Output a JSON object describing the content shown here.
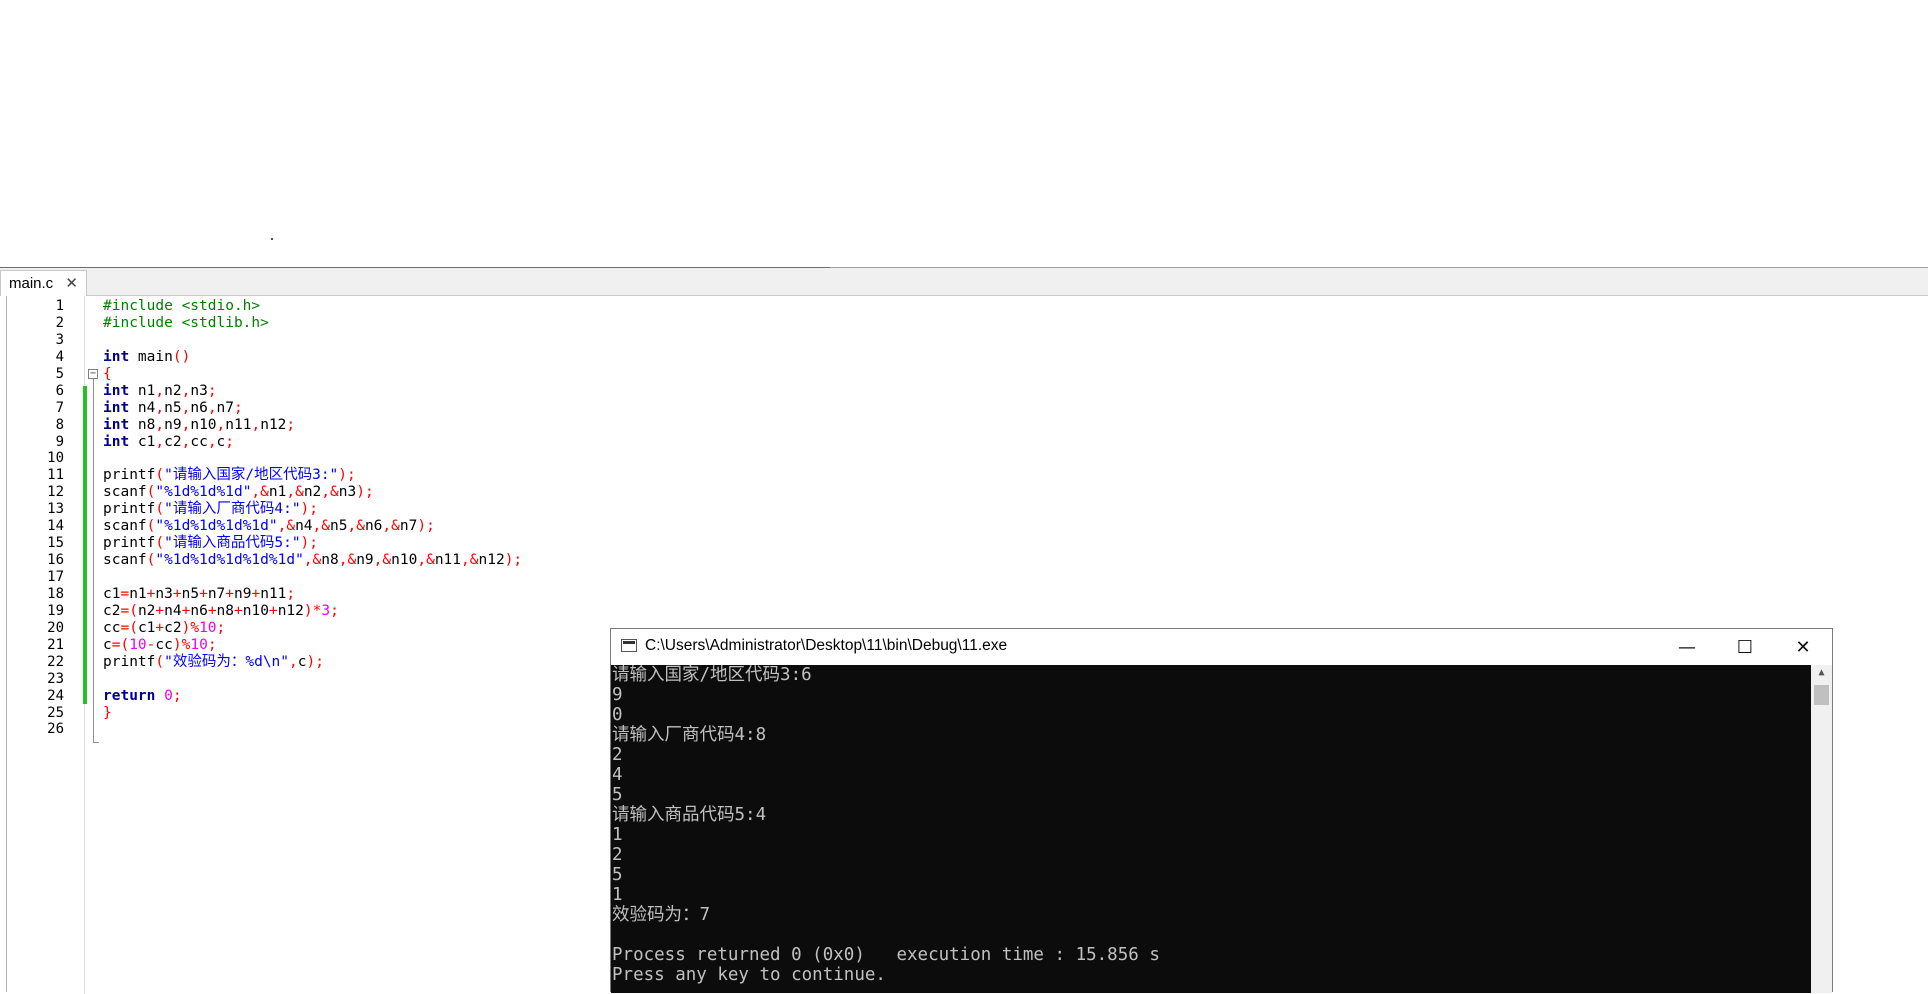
{
  "editor": {
    "tab_label": "main.c",
    "tab_close": "✕",
    "fold_glyph": "−",
    "line_numbers": [
      "1",
      "2",
      "3",
      "4",
      "5",
      "6",
      "7",
      "8",
      "9",
      "10",
      "11",
      "12",
      "13",
      "14",
      "15",
      "16",
      "17",
      "18",
      "19",
      "20",
      "21",
      "22",
      "23",
      "24",
      "25",
      "26"
    ],
    "code_lines": [
      [
        [
          "#include <stdio.h>",
          "pp"
        ]
      ],
      [
        [
          "#include <stdlib.h>",
          "pp"
        ]
      ],
      [],
      [
        [
          "int",
          "kw"
        ],
        [
          " main",
          ""
        ],
        [
          "()",
          "op"
        ]
      ],
      [
        [
          "{",
          "op"
        ]
      ],
      [
        [
          "int",
          "kw"
        ],
        [
          " n1",
          ""
        ],
        [
          ",",
          "op"
        ],
        [
          "n2",
          ""
        ],
        [
          ",",
          "op"
        ],
        [
          "n3",
          ""
        ],
        [
          ";",
          "op"
        ]
      ],
      [
        [
          "int",
          "kw"
        ],
        [
          " n4",
          ""
        ],
        [
          ",",
          "op"
        ],
        [
          "n5",
          ""
        ],
        [
          ",",
          "op"
        ],
        [
          "n6",
          ""
        ],
        [
          ",",
          "op"
        ],
        [
          "n7",
          ""
        ],
        [
          ";",
          "op"
        ]
      ],
      [
        [
          "int",
          "kw"
        ],
        [
          " n8",
          ""
        ],
        [
          ",",
          "op"
        ],
        [
          "n9",
          ""
        ],
        [
          ",",
          "op"
        ],
        [
          "n10",
          ""
        ],
        [
          ",",
          "op"
        ],
        [
          "n11",
          ""
        ],
        [
          ",",
          "op"
        ],
        [
          "n12",
          ""
        ],
        [
          ";",
          "op"
        ]
      ],
      [
        [
          "int",
          "kw"
        ],
        [
          " c1",
          ""
        ],
        [
          ",",
          "op"
        ],
        [
          "c2",
          ""
        ],
        [
          ",",
          "op"
        ],
        [
          "cc",
          ""
        ],
        [
          ",",
          "op"
        ],
        [
          "c",
          ""
        ],
        [
          ";",
          "op"
        ]
      ],
      [],
      [
        [
          "printf",
          ""
        ],
        [
          "(",
          "op"
        ],
        [
          "\"请输入国家/地区代码3:\"",
          "st"
        ],
        [
          ");",
          "op"
        ]
      ],
      [
        [
          "scanf",
          ""
        ],
        [
          "(",
          "op"
        ],
        [
          "\"%1d%1d%1d\"",
          "st"
        ],
        [
          ",&",
          "op"
        ],
        [
          "n1",
          ""
        ],
        [
          ",&",
          "op"
        ],
        [
          "n2",
          ""
        ],
        [
          ",&",
          "op"
        ],
        [
          "n3",
          ""
        ],
        [
          ");",
          "op"
        ]
      ],
      [
        [
          "printf",
          ""
        ],
        [
          "(",
          "op"
        ],
        [
          "\"请输入厂商代码4:\"",
          "st"
        ],
        [
          ");",
          "op"
        ]
      ],
      [
        [
          "scanf",
          ""
        ],
        [
          "(",
          "op"
        ],
        [
          "\"%1d%1d%1d%1d\"",
          "st"
        ],
        [
          ",&",
          "op"
        ],
        [
          "n4",
          ""
        ],
        [
          ",&",
          "op"
        ],
        [
          "n5",
          ""
        ],
        [
          ",&",
          "op"
        ],
        [
          "n6",
          ""
        ],
        [
          ",&",
          "op"
        ],
        [
          "n7",
          ""
        ],
        [
          ");",
          "op"
        ]
      ],
      [
        [
          "printf",
          ""
        ],
        [
          "(",
          "op"
        ],
        [
          "\"请输入商品代码5:\"",
          "st"
        ],
        [
          ");",
          "op"
        ]
      ],
      [
        [
          "scanf",
          ""
        ],
        [
          "(",
          "op"
        ],
        [
          "\"%1d%1d%1d%1d%1d\"",
          "st"
        ],
        [
          ",&",
          "op"
        ],
        [
          "n8",
          ""
        ],
        [
          ",&",
          "op"
        ],
        [
          "n9",
          ""
        ],
        [
          ",&",
          "op"
        ],
        [
          "n10",
          ""
        ],
        [
          ",&",
          "op"
        ],
        [
          "n11",
          ""
        ],
        [
          ",&",
          "op"
        ],
        [
          "n12",
          ""
        ],
        [
          ");",
          "op"
        ]
      ],
      [],
      [
        [
          "c1",
          ""
        ],
        [
          "=",
          "op"
        ],
        [
          "n1",
          ""
        ],
        [
          "+",
          "op"
        ],
        [
          "n3",
          ""
        ],
        [
          "+",
          "op"
        ],
        [
          "n5",
          ""
        ],
        [
          "+",
          "op"
        ],
        [
          "n7",
          ""
        ],
        [
          "+",
          "op"
        ],
        [
          "n9",
          ""
        ],
        [
          "+",
          "op"
        ],
        [
          "n11",
          ""
        ],
        [
          ";",
          "op"
        ]
      ],
      [
        [
          "c2",
          ""
        ],
        [
          "=(",
          "op"
        ],
        [
          "n2",
          ""
        ],
        [
          "+",
          "op"
        ],
        [
          "n4",
          ""
        ],
        [
          "+",
          "op"
        ],
        [
          "n6",
          ""
        ],
        [
          "+",
          "op"
        ],
        [
          "n8",
          ""
        ],
        [
          "+",
          "op"
        ],
        [
          "n10",
          ""
        ],
        [
          "+",
          "op"
        ],
        [
          "n12",
          ""
        ],
        [
          ")*",
          "op"
        ],
        [
          "3",
          "nm"
        ],
        [
          ";",
          "op"
        ]
      ],
      [
        [
          "cc",
          ""
        ],
        [
          "=(",
          "op"
        ],
        [
          "c1",
          ""
        ],
        [
          "+",
          "op"
        ],
        [
          "c2",
          ""
        ],
        [
          ")%",
          "op"
        ],
        [
          "10",
          "nm"
        ],
        [
          ";",
          "op"
        ]
      ],
      [
        [
          "c",
          ""
        ],
        [
          "=(",
          "op"
        ],
        [
          "10",
          "nm"
        ],
        [
          "-",
          "op"
        ],
        [
          "cc",
          ""
        ],
        [
          ")%",
          "op"
        ],
        [
          "10",
          "nm"
        ],
        [
          ";",
          "op"
        ]
      ],
      [
        [
          "printf",
          ""
        ],
        [
          "(",
          "op"
        ],
        [
          "\"效验码为：%d\\n\"",
          "st"
        ],
        [
          ",",
          "op"
        ],
        [
          "c",
          ""
        ],
        [
          ");",
          "op"
        ]
      ],
      [],
      [
        [
          "return",
          "kw"
        ],
        [
          " ",
          ""
        ],
        [
          "0",
          "nm"
        ],
        [
          ";",
          "op"
        ]
      ],
      [
        [
          "}",
          "op"
        ]
      ],
      []
    ]
  },
  "console": {
    "title": "C:\\Users\\Administrator\\Desktop\\11\\bin\\Debug\\11.exe",
    "minimize_glyph": "—",
    "maximize_glyph": "☐",
    "close_glyph": "✕",
    "scroll_up_glyph": "▲",
    "lines": [
      "请输入国家/地区代码3:6",
      "9",
      "0",
      "请输入厂商代码4:8",
      "2",
      "4",
      "5",
      "请输入商品代码5:4",
      "1",
      "2",
      "5",
      "1",
      "效验码为：7",
      "",
      "Process returned 0 (0x0)   execution time : 15.856 s",
      "Press any key to continue."
    ]
  }
}
